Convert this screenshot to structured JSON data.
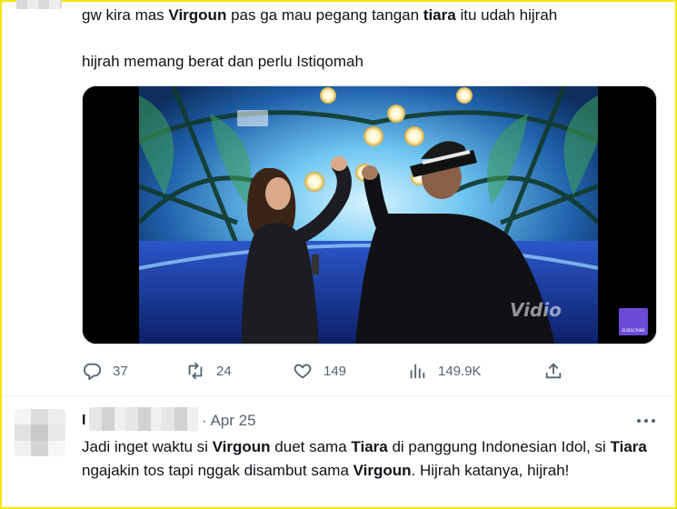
{
  "tweet": {
    "line1": {
      "p1": "gw kira mas ",
      "b1": "Virgoun",
      "p2": " pas ga mau pegang tangan ",
      "b2": "tiara",
      "p3": " itu udah hijrah"
    },
    "line2": "hijrah memang berat dan perlu Istiqomah",
    "media": {
      "watermark": "Vidio",
      "subscribe_badge": "SUBSCRIBE"
    },
    "actions": {
      "replies": "37",
      "retweets": "24",
      "likes": "149",
      "views": "149.9K"
    }
  },
  "reply": {
    "name": "I",
    "separator": "·",
    "date": "Apr 25",
    "text": {
      "p1": "Jadi inget waktu si ",
      "b1": "Virgoun",
      "p2": " duet sama ",
      "b2": "Tiara",
      "p3": " di panggung Indonesian Idol, si ",
      "b3": "Tiara",
      "p4": " ngajakin tos tapi nggak disambut sama ",
      "b4": "Virgoun",
      "p5": ". Hijrah katanya, hijrah!"
    }
  },
  "icons": [
    "reply-icon",
    "retweet-icon",
    "like-icon",
    "views-icon",
    "share-icon",
    "more-icon"
  ],
  "colors": {
    "text": "#0f1419",
    "muted": "#536471",
    "frame": "#f2e600"
  }
}
